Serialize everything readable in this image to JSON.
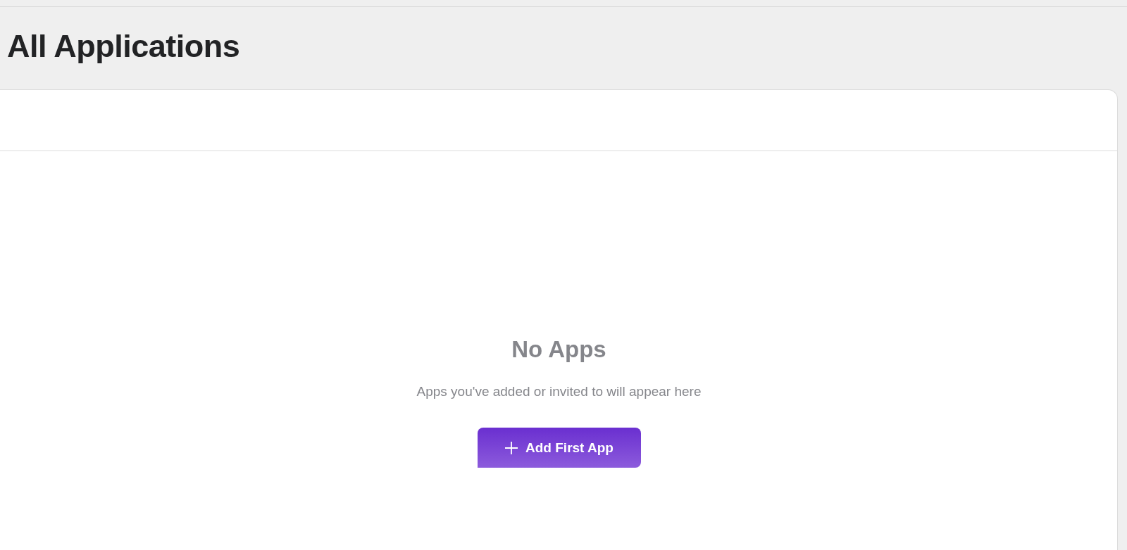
{
  "page": {
    "title": "All Applications"
  },
  "empty_state": {
    "heading": "No Apps",
    "message": "Apps you've added or invited to will appear here",
    "button": {
      "label": "Add First App"
    }
  }
}
